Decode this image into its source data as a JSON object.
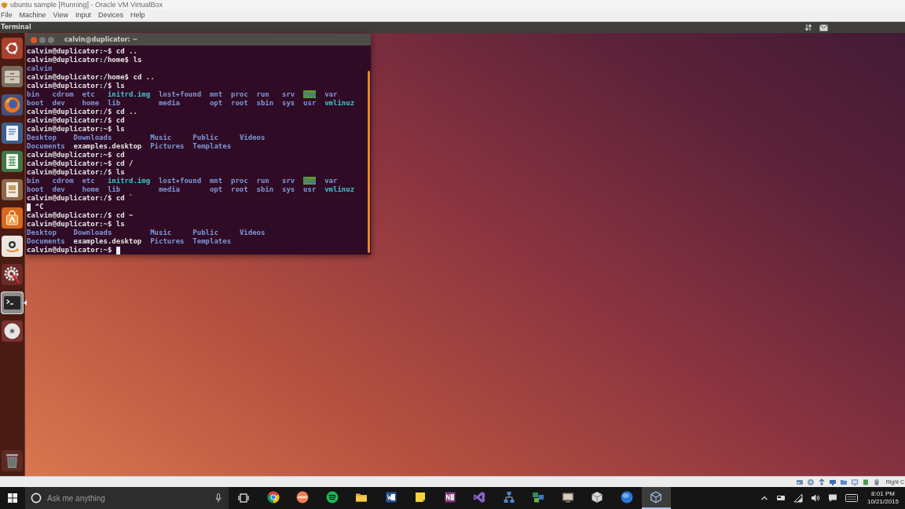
{
  "window": {
    "title": "ubuntu sample [Running] - Oracle VM VirtualBox"
  },
  "menu_bar": [
    "File",
    "Machine",
    "View",
    "Input",
    "Devices",
    "Help"
  ],
  "top_panel": {
    "title": "Terminal"
  },
  "launcher": [
    {
      "selected": false
    },
    {
      "selected": false
    },
    {
      "selected": false
    },
    {
      "selected": false
    },
    {
      "selected": false
    },
    {
      "selected": false
    },
    {
      "selected": false
    },
    {
      "selected": false
    },
    {
      "selected": false
    },
    {
      "selected": true
    },
    {
      "selected": false
    }
  ],
  "terminal": {
    "title": "calvin@duplicator: ~",
    "cursor": true,
    "lines": [
      {
        "kind": "command",
        "text": "calvin@duplicator:~$ cd .."
      },
      {
        "kind": "command",
        "text": "calvin@duplicator:/home$ ls"
      },
      {
        "kind": "listing",
        "rows": [
          [
            {
              "text": "calvin",
              "kind": "dir"
            }
          ]
        ]
      },
      {
        "kind": "command",
        "text": "calvin@duplicator:/home$ cd .."
      },
      {
        "kind": "command",
        "text": "calvin@duplicator:/$ ls"
      },
      {
        "kind": "listing",
        "rows": [
          [
            {
              "text": "bin",
              "kind": "dir"
            },
            {
              "text": "cdrom",
              "kind": "dir"
            },
            {
              "text": "etc",
              "kind": "dir"
            },
            {
              "text": "initrd.img",
              "kind": "link"
            },
            {
              "text": "lost+found",
              "kind": "dir"
            },
            {
              "text": "mnt",
              "kind": "dir"
            },
            {
              "text": "proc",
              "kind": "dir"
            },
            {
              "text": "run",
              "kind": "dir"
            },
            {
              "text": "srv",
              "kind": "dir"
            },
            {
              "text": "tmp",
              "kind": "sticky"
            },
            {
              "text": "var",
              "kind": "dir"
            }
          ],
          [
            {
              "text": "boot",
              "kind": "dir"
            },
            {
              "text": "dev",
              "kind": "dir"
            },
            {
              "text": "home",
              "kind": "dir"
            },
            {
              "text": "lib",
              "kind": "dir"
            },
            {
              "text": "media",
              "kind": "dir"
            },
            {
              "text": "opt",
              "kind": "dir"
            },
            {
              "text": "root",
              "kind": "dir"
            },
            {
              "text": "sbin",
              "kind": "dir"
            },
            {
              "text": "sys",
              "kind": "dir"
            },
            {
              "text": "usr",
              "kind": "dir"
            },
            {
              "text": "vmlinuz",
              "kind": "link"
            }
          ]
        ]
      },
      {
        "kind": "command",
        "text": "calvin@duplicator:/$ cd .."
      },
      {
        "kind": "command",
        "text": "calvin@duplicator:/$ cd"
      },
      {
        "kind": "command",
        "text": "calvin@duplicator:~$ ls"
      },
      {
        "kind": "listing",
        "rows": [
          [
            {
              "text": "Desktop",
              "kind": "dir"
            },
            {
              "text": "Downloads",
              "kind": "dir"
            },
            {
              "text": "Music",
              "kind": "dir"
            },
            {
              "text": "Public",
              "kind": "dir"
            },
            {
              "text": "Videos",
              "kind": "dir"
            }
          ],
          [
            {
              "text": "Documents",
              "kind": "dir"
            },
            {
              "text": "examples.desktop",
              "kind": "file"
            },
            {
              "text": "Pictures",
              "kind": "dir"
            },
            {
              "text": "Templates",
              "kind": "dir"
            }
          ]
        ]
      },
      {
        "kind": "command",
        "text": "calvin@duplicator:~$ cd"
      },
      {
        "kind": "command",
        "text": "calvin@duplicator:~$ cd /"
      },
      {
        "kind": "command",
        "text": "calvin@duplicator:/$ ls"
      },
      {
        "kind": "listing",
        "rows": [
          [
            {
              "text": "bin",
              "kind": "dir"
            },
            {
              "text": "cdrom",
              "kind": "dir"
            },
            {
              "text": "etc",
              "kind": "dir"
            },
            {
              "text": "initrd.img",
              "kind": "link"
            },
            {
              "text": "lost+found",
              "kind": "dir"
            },
            {
              "text": "mnt",
              "kind": "dir"
            },
            {
              "text": "proc",
              "kind": "dir"
            },
            {
              "text": "run",
              "kind": "dir"
            },
            {
              "text": "srv",
              "kind": "dir"
            },
            {
              "text": "tmp",
              "kind": "sticky"
            },
            {
              "text": "var",
              "kind": "dir"
            }
          ],
          [
            {
              "text": "boot",
              "kind": "dir"
            },
            {
              "text": "dev",
              "kind": "dir"
            },
            {
              "text": "home",
              "kind": "dir"
            },
            {
              "text": "lib",
              "kind": "dir"
            },
            {
              "text": "media",
              "kind": "dir"
            },
            {
              "text": "opt",
              "kind": "dir"
            },
            {
              "text": "root",
              "kind": "dir"
            },
            {
              "text": "sbin",
              "kind": "dir"
            },
            {
              "text": "sys",
              "kind": "dir"
            },
            {
              "text": "usr",
              "kind": "dir"
            },
            {
              "text": "vmlinuz",
              "kind": "link"
            }
          ]
        ]
      },
      {
        "kind": "command",
        "text": "calvin@duplicator:/$ cd `"
      },
      {
        "kind": "interrupt",
        "text": "^C"
      },
      {
        "kind": "command",
        "text": "calvin@duplicator:/$ cd ~"
      },
      {
        "kind": "command",
        "text": "calvin@duplicator:~$ ls"
      },
      {
        "kind": "listing",
        "rows": [
          [
            {
              "text": "Desktop",
              "kind": "dir"
            },
            {
              "text": "Downloads",
              "kind": "dir"
            },
            {
              "text": "Music",
              "kind": "dir"
            },
            {
              "text": "Public",
              "kind": "dir"
            },
            {
              "text": "Videos",
              "kind": "dir"
            }
          ],
          [
            {
              "text": "Documents",
              "kind": "dir"
            },
            {
              "text": "examples.desktop",
              "kind": "file"
            },
            {
              "text": "Pictures",
              "kind": "dir"
            },
            {
              "text": "Templates",
              "kind": "dir"
            }
          ]
        ]
      },
      {
        "kind": "command",
        "text": "calvin@duplicator:~$"
      }
    ]
  },
  "status_bar": {
    "host_key": "Right C"
  },
  "taskbar": {
    "search": {
      "placeholder": "Ask me anything"
    },
    "apps": [
      {
        "selected": false
      },
      {
        "selected": false
      },
      {
        "selected": false
      },
      {
        "selected": false
      },
      {
        "selected": false
      },
      {
        "selected": false
      },
      {
        "selected": false
      },
      {
        "selected": false
      },
      {
        "selected": false
      },
      {
        "selected": false
      },
      {
        "selected": false
      },
      {
        "selected": false
      },
      {
        "selected": false
      },
      {
        "selected": true
      }
    ],
    "clock": {
      "time": "8:01 PM",
      "date": "10/21/2015"
    }
  }
}
